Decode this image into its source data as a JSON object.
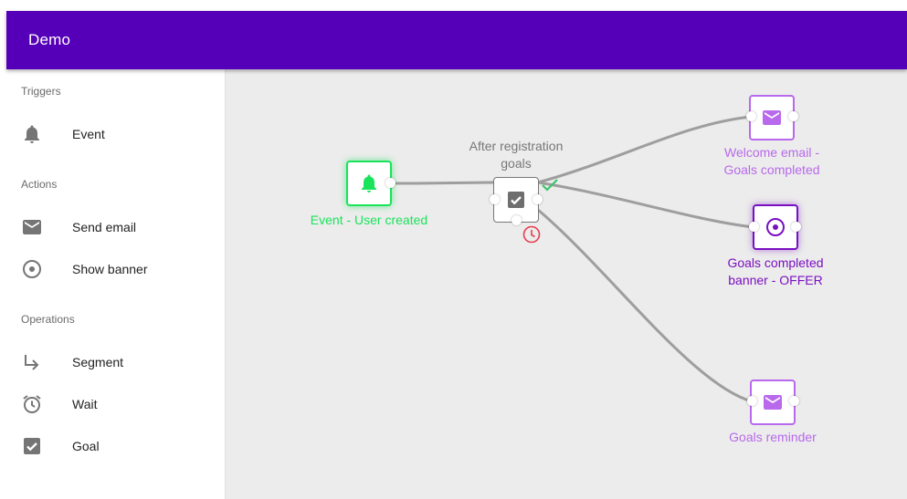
{
  "app": {
    "title": "Demo"
  },
  "sidebar": {
    "sections": [
      {
        "label": "Triggers",
        "items": [
          {
            "label": "Event",
            "icon": "bell-icon"
          }
        ]
      },
      {
        "label": "Actions",
        "items": [
          {
            "label": "Send email",
            "icon": "email-icon"
          },
          {
            "label": "Show banner",
            "icon": "target-icon"
          }
        ]
      },
      {
        "label": "Operations",
        "items": [
          {
            "label": "Segment",
            "icon": "subdirectory-arrow-icon"
          },
          {
            "label": "Wait",
            "icon": "alarm-icon"
          },
          {
            "label": "Goal",
            "icon": "checkbox-icon"
          }
        ]
      }
    ]
  },
  "flow": {
    "nodes": {
      "event": {
        "label": "Event - User created",
        "icon": "bell-icon",
        "color": "#19e35a"
      },
      "goal": {
        "label": "After registration goals",
        "icon": "checkbox-icon",
        "color": "#777777",
        "success_icon": "checkmark-icon",
        "timeout_icon": "clock-icon",
        "success_color": "#3ec46d",
        "timeout_color": "#e53e4f"
      },
      "welcome_email": {
        "label": "Welcome email - Goals completed",
        "icon": "email-icon",
        "color": "#b869ec"
      },
      "banner": {
        "label": "Goals completed banner - OFFER",
        "icon": "target-icon",
        "color": "#7a0fc2"
      },
      "reminder": {
        "label": "Goals reminder",
        "icon": "email-icon",
        "color": "#b869ec"
      }
    },
    "link_color": "#9e9e9e"
  },
  "colors": {
    "app_bar": "#5500b8",
    "canvas": "#ececec"
  }
}
